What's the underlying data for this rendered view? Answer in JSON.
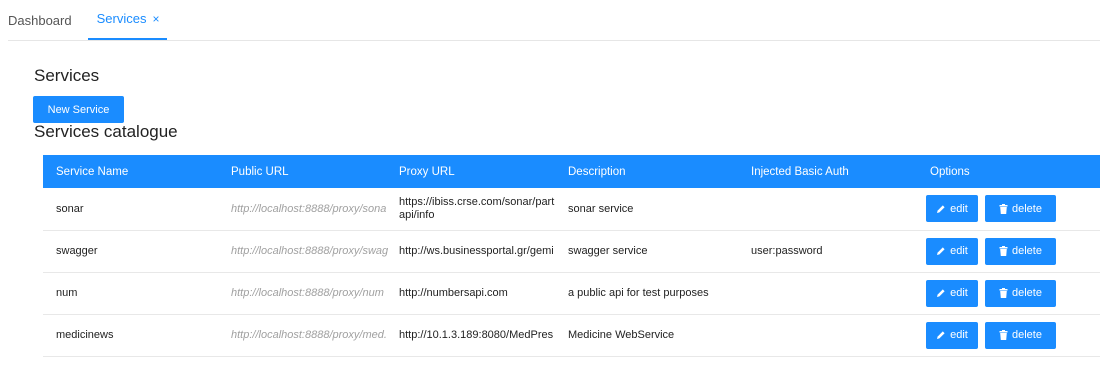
{
  "tabs": [
    {
      "label": "Dashboard"
    },
    {
      "label": "Services",
      "close": "×"
    }
  ],
  "page": {
    "title": "Services",
    "new_button": "New Service",
    "catalogue_title": "Services catalogue"
  },
  "table": {
    "headers": [
      "Service Name",
      "Public URL",
      "Proxy URL",
      "Description",
      "Injected Basic Auth",
      "Options"
    ],
    "rows": [
      {
        "name": "sonar",
        "public_url": "http://localhost:8888/proxy/sona",
        "proxy_url": "https://ibiss.crse.com/sonar/part api/info",
        "description": "sonar service",
        "auth": ""
      },
      {
        "name": "swagger",
        "public_url": "http://localhost:8888/proxy/swag",
        "proxy_url": "http://ws.businessportal.gr/gemi",
        "description": "swagger service",
        "auth": "user:password"
      },
      {
        "name": "num",
        "public_url": "http://localhost:8888/proxy/num",
        "proxy_url": "http://numbersapi.com",
        "description": "a public api for test purposes",
        "auth": ""
      },
      {
        "name": "medicinews",
        "public_url": "http://localhost:8888/proxy/med.",
        "proxy_url": "http://10.1.3.189:8080/MedPres",
        "description": "Medicine WebService",
        "auth": ""
      }
    ],
    "edit_label": "edit",
    "delete_label": "delete"
  },
  "colors": {
    "accent": "#1a8cff"
  },
  "icons": {
    "edit": "pencil-icon",
    "delete": "trash-icon",
    "close": "close-icon"
  }
}
